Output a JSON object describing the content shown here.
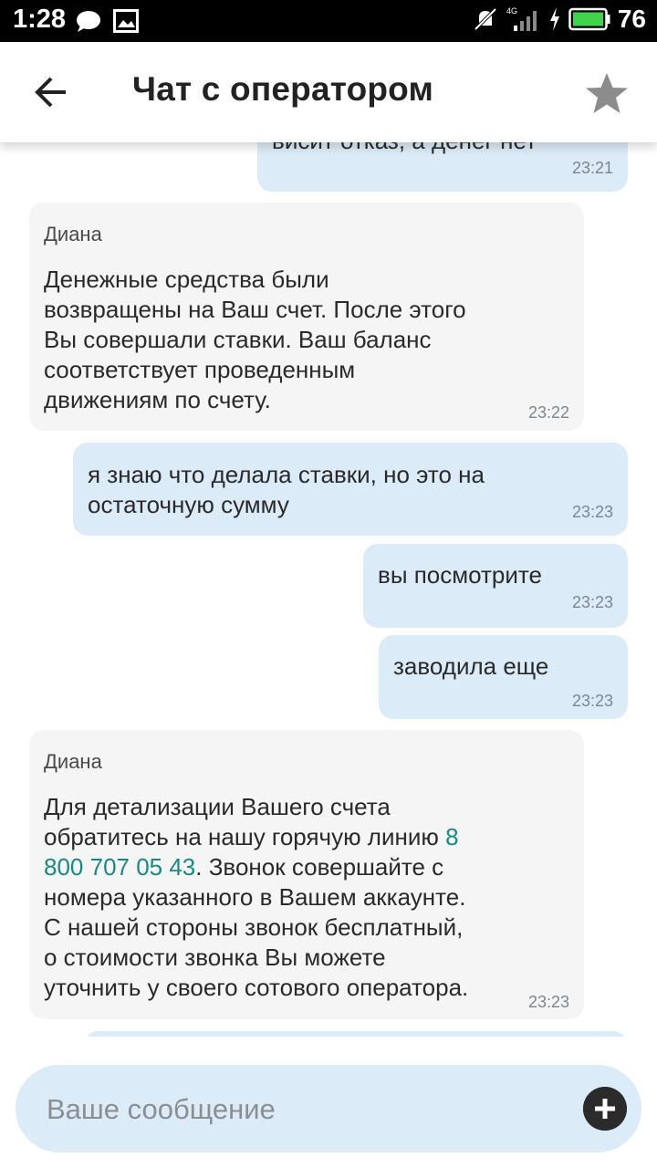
{
  "status_bar": {
    "time": "1:28",
    "battery_percent": "76",
    "network": "4G"
  },
  "header": {
    "title": "Чат с оператором"
  },
  "messages": [
    {
      "direction": "out",
      "text": "висит отказ, а денег нет",
      "time": "23:21"
    },
    {
      "direction": "in",
      "sender": "Диана",
      "text": "Денежные средства были\nвозвращены на Ваш счет. После этого\nВы совершали ставки. Ваш баланс\nсоответствует проведенным\nдвижениям по счету.",
      "time": "23:22"
    },
    {
      "direction": "out",
      "text": "я знаю что делала ставки,  но это на\nостаточную сумму",
      "time": "23:23"
    },
    {
      "direction": "out",
      "text": "вы посмотрите",
      "time": "23:23"
    },
    {
      "direction": "out",
      "text": "заводила еще",
      "time": "23:23"
    },
    {
      "direction": "in",
      "sender": "Диана",
      "text_before": "Для детализации Вашего счета\nобратитесь на нашу горячую линию ",
      "phone": "8\n800 707 05 43",
      "text_after": ". Звонок совершайте с\nномера указанного в Вашем аккаунте.\nС нашей стороны звонок бесплатный,\nо стоимости звонка Вы можете\nуточнить у своего сотового оператора.",
      "time": "23:23"
    }
  ],
  "composer": {
    "placeholder": "Ваше сообщение"
  },
  "colors": {
    "incoming_bubble": "#f5f5f5",
    "outgoing_bubble": "#dcebf8",
    "link": "#168b85",
    "composer_bg": "#dcebf8"
  },
  "icons": {
    "back": "arrow-left-icon",
    "favorite": "star-icon",
    "add": "plus-circle-icon",
    "battery": "battery-icon",
    "signal": "signal-icon"
  }
}
